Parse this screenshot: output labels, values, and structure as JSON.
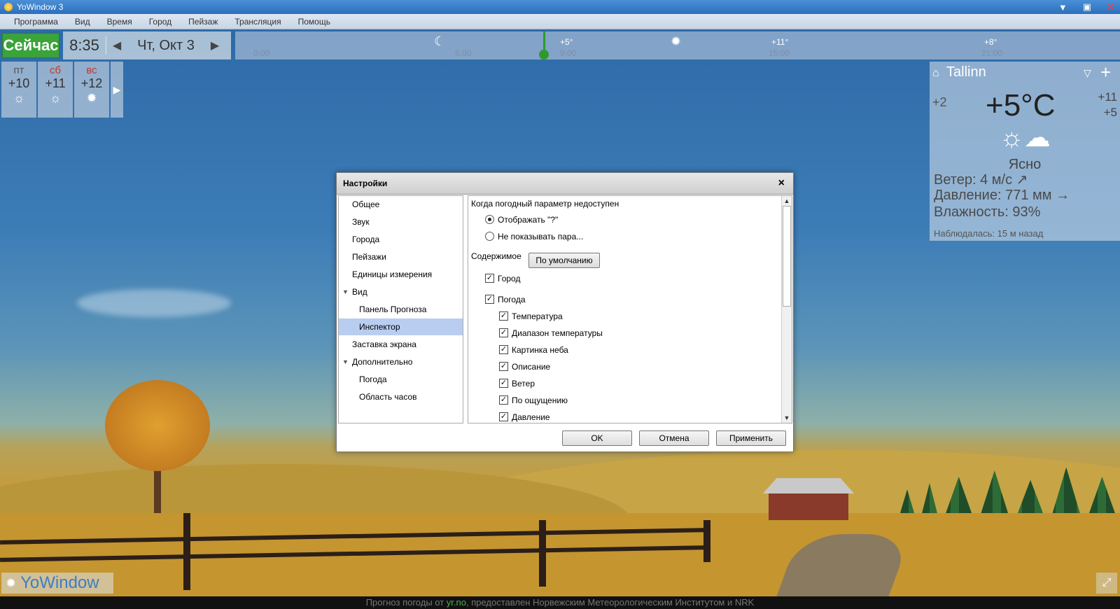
{
  "window": {
    "title": "YoWindow 3"
  },
  "menu": [
    "Программа",
    "Вид",
    "Время",
    "Город",
    "Пейзаж",
    "Трансляция",
    "Помощь"
  ],
  "topbar": {
    "now_label": "Сейчас",
    "time": "8:35",
    "date": "Чт, Окт 3",
    "timeline_ticks": [
      "0:00",
      "6:00",
      "9:00",
      "15:00",
      "21:00"
    ],
    "timeline_temps": [
      "+5°",
      "+11°",
      "+8°"
    ]
  },
  "days": [
    {
      "name": "пт",
      "temp": "+10",
      "weekend": false
    },
    {
      "name": "сб",
      "temp": "+11",
      "weekend": true
    },
    {
      "name": "вс",
      "temp": "+12",
      "weekend": true
    }
  ],
  "inspector": {
    "city": "Tallinn",
    "feels_like": "+2",
    "temperature": "+5°C",
    "range_high": "+11",
    "range_low": "+5",
    "description": "Ясно",
    "wind": "Ветер:  4 м/с ↗",
    "pressure": "Давление:  771 мм →",
    "humidity": "Влажность:  93%",
    "observed": "Наблюдалась:  15 м назад"
  },
  "dialog": {
    "title": "Настройки",
    "nav": [
      {
        "label": "Общее",
        "level": 0
      },
      {
        "label": "Звук",
        "level": 0
      },
      {
        "label": "Города",
        "level": 0
      },
      {
        "label": "Пейзажи",
        "level": 0
      },
      {
        "label": "Единицы измерения",
        "level": 0
      },
      {
        "label": "Вид",
        "level": 0,
        "expanded": true
      },
      {
        "label": "Панель Прогноза",
        "level": 1
      },
      {
        "label": "Инспектор",
        "level": 1,
        "selected": true
      },
      {
        "label": "Заставка экрана",
        "level": 0
      },
      {
        "label": "Дополнительно",
        "level": 0,
        "expanded": true
      },
      {
        "label": "Погода",
        "level": 1
      },
      {
        "label": "Область часов",
        "level": 1
      }
    ],
    "unavailable_heading": "Когда погодный параметр недоступен",
    "radio_show": "Отображать \"?\"",
    "radio_hide": "Не показывать пара...",
    "content_label": "Содержимое",
    "default_button": "По умолчанию",
    "checks": {
      "city": "Город",
      "weather": "Погода",
      "temperature": "Температура",
      "temp_range": "Диапазон температуры",
      "sky_picture": "Картинка неба",
      "description": "Описание",
      "wind": "Ветер",
      "feels_like": "По ощущению",
      "pressure": "Давление"
    },
    "ok": "OK",
    "cancel": "Отмена",
    "apply": "Применить"
  },
  "bottom": {
    "logo": "YoWindow",
    "credit_prefix": "Прогноз погоды от ",
    "credit_source": "yr.no",
    "credit_suffix": ", предоставлен Норвежским Метеорологическим Институтом и NRK"
  }
}
